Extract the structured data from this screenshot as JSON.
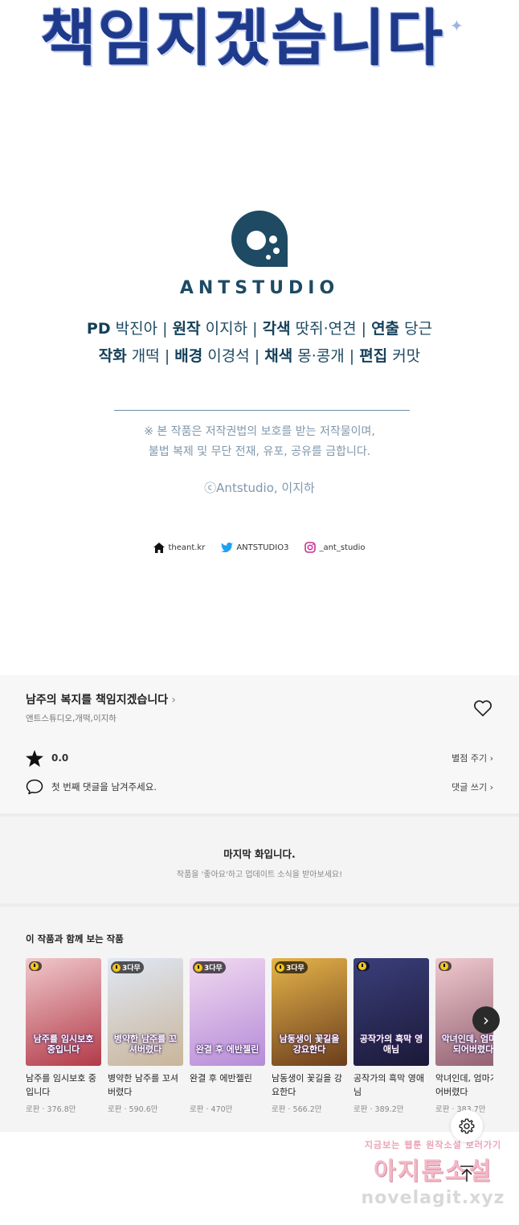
{
  "title_art": {
    "text": "책임지겠습니다"
  },
  "brand": {
    "name": "ANTSTUDIO"
  },
  "credits": {
    "line1": [
      {
        "role": "PD",
        "name": "박진아"
      },
      {
        "role": "원작",
        "name": "이지하"
      },
      {
        "role": "각색",
        "name": "땃쥐·연견"
      },
      {
        "role": "연출",
        "name": "당근"
      }
    ],
    "line2": [
      {
        "role": "작화",
        "name": "개떡"
      },
      {
        "role": "배경",
        "name": "이경석"
      },
      {
        "role": "채색",
        "name": "몽·콩개"
      },
      {
        "role": "편집",
        "name": "커맛"
      }
    ],
    "separator": "|"
  },
  "notice": {
    "line1": "※ 본 작품은 저작권법의 보호를 받는 저작물이며,",
    "line2": "불법 복제 및 무단 전재, 유포, 공유를 금합니다.",
    "copyright": "ⓒAntstudio, 이지하"
  },
  "social": {
    "home": "theant.kr",
    "twitter": "ANTSTUDIO3",
    "instagram": "_ant_studio"
  },
  "series": {
    "title": "남주의 복지를 책임지겠습니다",
    "chevron": "›",
    "authors": "앤트스튜디오,개떡,이지하"
  },
  "rating": {
    "value": "0.0",
    "action": "별점 주기 ›"
  },
  "comment": {
    "prompt": "첫 번째 댓글을 남겨주세요.",
    "action": "댓글 쓰기 ›"
  },
  "last_episode": {
    "title": "마지막 화입니다.",
    "subtitle": "작품을 '좋아요'하고 업데이트 소식을 받아보세요!"
  },
  "recommendations": {
    "heading": "이 작품과 함께 보는 작품",
    "items": [
      {
        "name": "남주를 임시보호 중입니다",
        "genre": "로판",
        "views": "376.8만",
        "badge": "",
        "cover_text": "남주를 임시보호 중입니다",
        "colors": [
          "#f0c8cc",
          "#b23a48"
        ]
      },
      {
        "name": "병약한 남주를 꼬셔버렸다",
        "genre": "로판",
        "views": "590.6만",
        "badge": "3다무",
        "cover_text": "병약한 남주를 꼬셔버렸다",
        "colors": [
          "#dfe7f5",
          "#c9b59a"
        ]
      },
      {
        "name": "완결 후 에반젤린",
        "genre": "로판",
        "views": "470만",
        "badge": "3다무",
        "cover_text": "완결 후 에반젤린",
        "colors": [
          "#f2d9f0",
          "#b58bd8"
        ]
      },
      {
        "name": "남동생이 꽃길을 강요한다",
        "genre": "로판",
        "views": "566.2만",
        "badge": "3다무",
        "cover_text": "남동생이 꽃길을 강요한다",
        "colors": [
          "#e5b44a",
          "#6a3d1c"
        ]
      },
      {
        "name": "공작가의 흑막 영애님",
        "genre": "로판",
        "views": "389.2만",
        "badge": "",
        "cover_text": "공작가의 흑막 영애님",
        "colors": [
          "#3a3f7a",
          "#1b1838"
        ]
      },
      {
        "name": "악녀인데, 엄마가 되어버렸다",
        "genre": "로판",
        "views": "383.7만",
        "badge": "",
        "cover_text": "악녀인데, 엄마가 되어버렸다",
        "colors": [
          "#f0c9cf",
          "#8e5d6e"
        ]
      }
    ],
    "meta_sep": " · "
  },
  "watermark": {
    "line1": "지금보는 웹툰 원작소설 보러가기",
    "line2": "아지툰소설",
    "line3": "novelagit.xyz"
  },
  "colors": {
    "brand": "#1e4a63",
    "panel_bg": "#f7f7f7",
    "accent_badge": "#f5c518"
  }
}
